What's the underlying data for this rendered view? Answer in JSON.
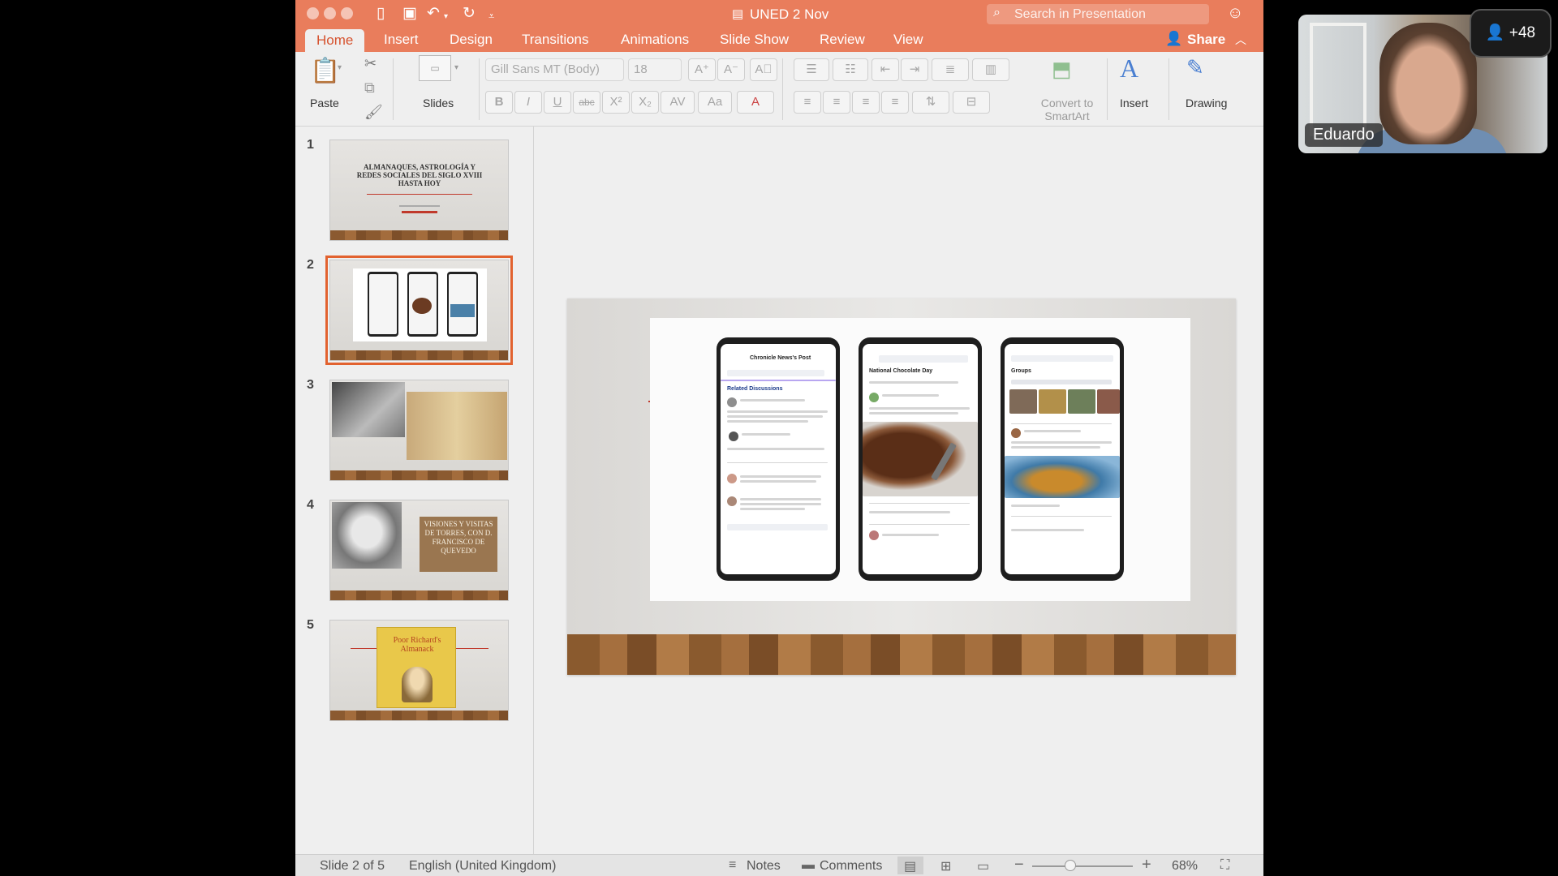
{
  "window": {
    "title": "UNED 2 Nov",
    "search_placeholder": "Search in Presentation"
  },
  "tabs": [
    "Home",
    "Insert",
    "Design",
    "Transitions",
    "Animations",
    "Slide Show",
    "Review",
    "View"
  ],
  "share_label": "Share",
  "ribbon": {
    "paste": "Paste",
    "slides": "Slides",
    "font_name": "Gill Sans MT (Body)",
    "font_size": "18",
    "convert_smartart_1": "Convert to",
    "convert_smartart_2": "SmartArt",
    "insert": "Insert",
    "drawing": "Drawing"
  },
  "slides": [
    {
      "number": "1",
      "title": "ALMANAQUES, ASTROLOGÍA Y REDES SOCIALES DEL SIGLO XVIII HASTA HOY"
    },
    {
      "number": "2"
    },
    {
      "number": "3"
    },
    {
      "number": "4",
      "caption": "VISIONES Y VISITAS DE TORRES, CON D. FRANCISCO DE QUEVEDO"
    },
    {
      "number": "5",
      "caption": "Poor Richard's Almanack"
    }
  ],
  "selected_slide": 2,
  "current_slide": {
    "phones": [
      {
        "header": "Chronicle News's Post",
        "section": "Related Discussions"
      },
      {
        "header": "National Chocolate Day",
        "section": "National Chocolate Day"
      },
      {
        "header": "Groups",
        "section": "Groups"
      }
    ]
  },
  "status": {
    "slide_counter": "Slide 2 of 5",
    "language": "English (United Kingdom)",
    "notes": "Notes",
    "comments": "Comments",
    "zoom": "68%",
    "zoom_level": 0.68
  },
  "video": {
    "name": "Eduardo",
    "participants": "+48"
  },
  "colors": {
    "accent": "#e97d5c",
    "active_tab_text": "#d6522e",
    "selection": "#e2622f"
  }
}
